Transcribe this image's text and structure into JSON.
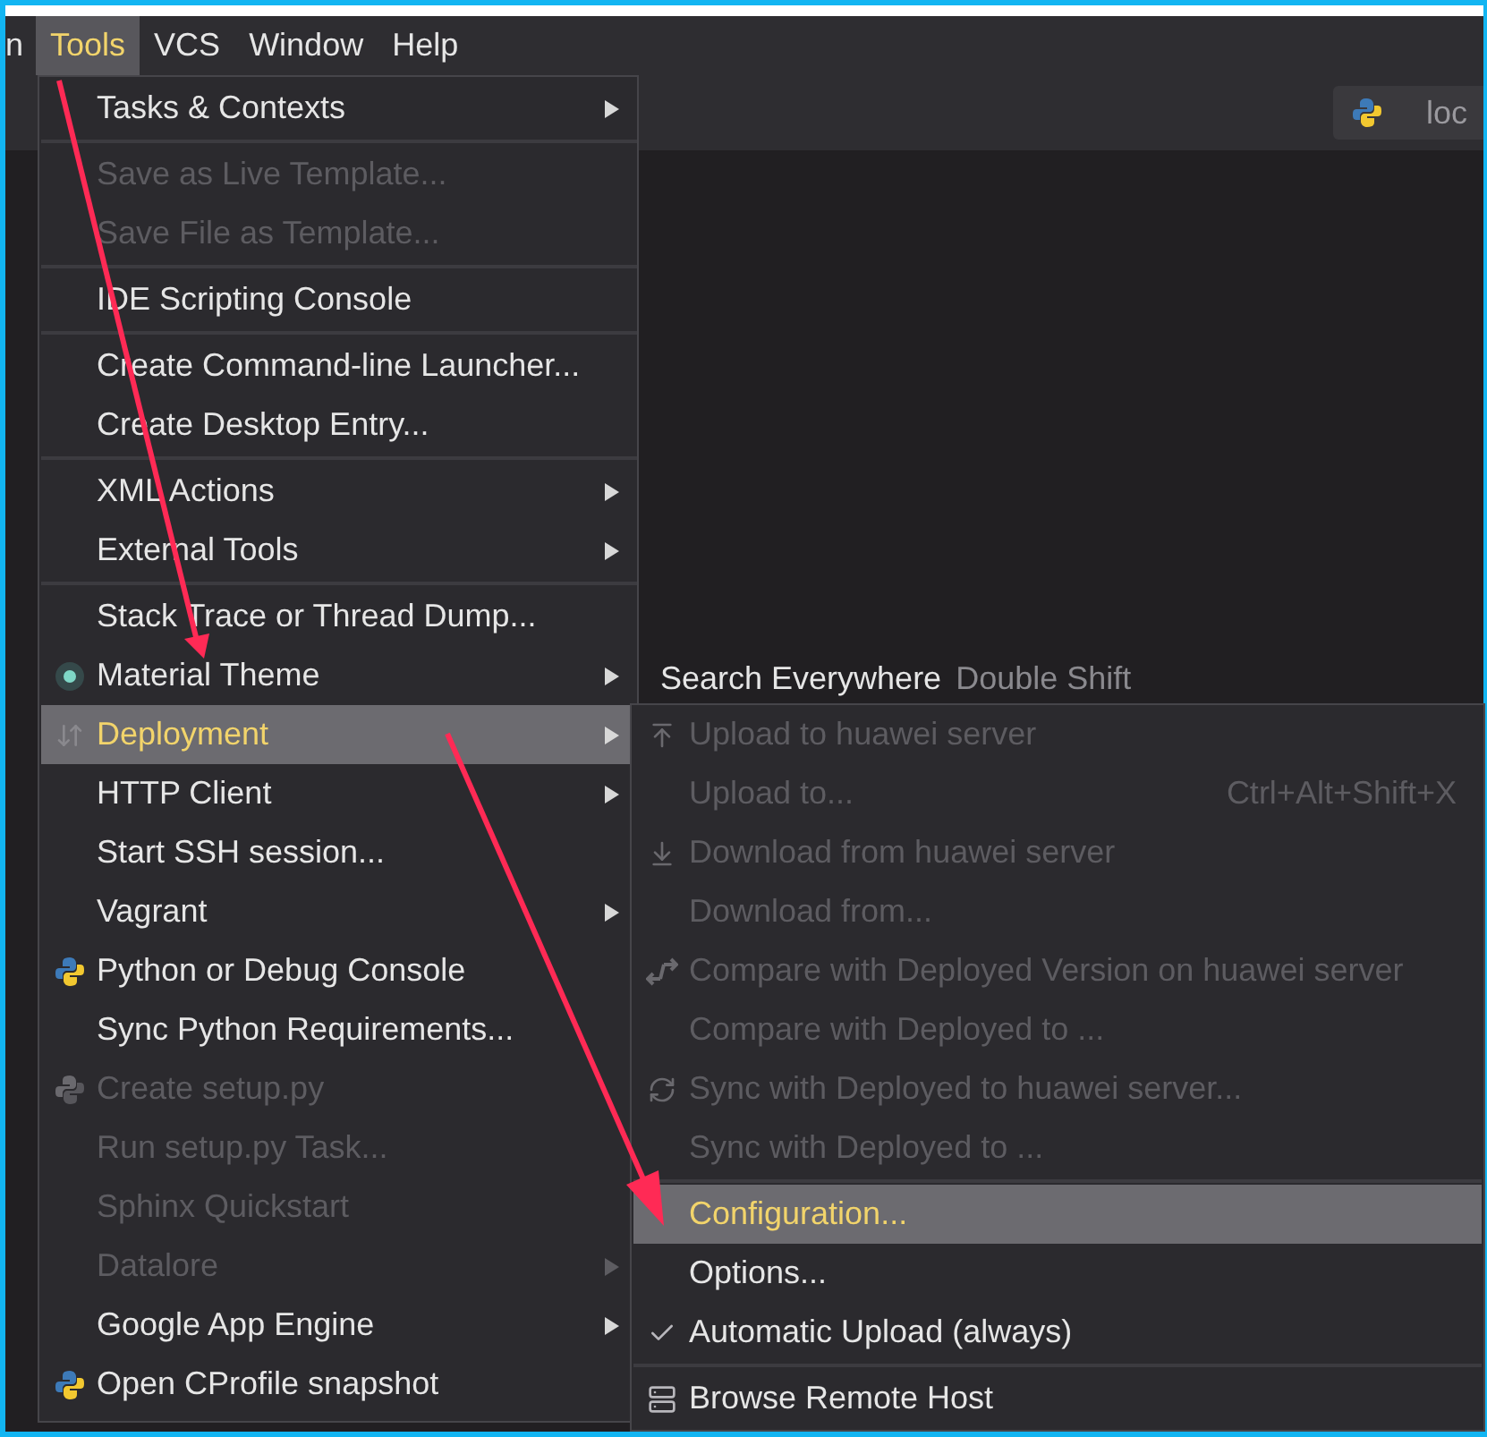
{
  "menu_bar": [
    {
      "label": "n",
      "selected": false
    },
    {
      "label": "Tools",
      "selected": true
    },
    {
      "label": "VCS",
      "selected": false
    },
    {
      "label": "Window",
      "selected": false
    },
    {
      "label": "Help",
      "selected": false
    }
  ],
  "editor_tab": {
    "label": "loc"
  },
  "hint": {
    "label": "Search Everywhere",
    "shortcut": "Double Shift"
  },
  "tools_menu": [
    {
      "kind": "item",
      "label": "Tasks & Contexts",
      "disabled": false,
      "submenu": true,
      "selected": false
    },
    {
      "kind": "separator"
    },
    {
      "kind": "item",
      "label": "Save as Live Template...",
      "disabled": true,
      "submenu": false,
      "selected": false
    },
    {
      "kind": "item",
      "label": "Save File as Template...",
      "disabled": true,
      "submenu": false,
      "selected": false
    },
    {
      "kind": "separator"
    },
    {
      "kind": "item",
      "label": "IDE Scripting Console",
      "disabled": false,
      "submenu": false,
      "selected": false
    },
    {
      "kind": "separator"
    },
    {
      "kind": "item",
      "label": "Create Command-line Launcher...",
      "disabled": false,
      "submenu": false,
      "selected": false
    },
    {
      "kind": "item",
      "label": "Create Desktop Entry...",
      "disabled": false,
      "submenu": false,
      "selected": false
    },
    {
      "kind": "separator"
    },
    {
      "kind": "item",
      "label": "XML Actions",
      "disabled": false,
      "submenu": true,
      "selected": false
    },
    {
      "kind": "item",
      "label": "External Tools",
      "disabled": false,
      "submenu": true,
      "selected": false
    },
    {
      "kind": "separator"
    },
    {
      "kind": "item",
      "label": "Stack Trace or Thread Dump...",
      "disabled": false,
      "submenu": false,
      "selected": false
    },
    {
      "kind": "item",
      "label": "Material Theme",
      "disabled": false,
      "submenu": true,
      "selected": false
    },
    {
      "kind": "item",
      "label": "Deployment",
      "disabled": false,
      "submenu": true,
      "selected": true
    },
    {
      "kind": "item",
      "label": "HTTP Client",
      "disabled": false,
      "submenu": true,
      "selected": false
    },
    {
      "kind": "item",
      "label": "Start SSH session...",
      "disabled": false,
      "submenu": false,
      "selected": false
    },
    {
      "kind": "item",
      "label": "Vagrant",
      "disabled": false,
      "submenu": true,
      "selected": false
    },
    {
      "kind": "item",
      "label": "Python or Debug Console",
      "disabled": false,
      "submenu": false,
      "selected": false
    },
    {
      "kind": "item",
      "label": "Sync Python Requirements...",
      "disabled": false,
      "submenu": false,
      "selected": false
    },
    {
      "kind": "item",
      "label": "Create setup.py",
      "disabled": true,
      "submenu": false,
      "selected": false
    },
    {
      "kind": "item",
      "label": "Run setup.py Task...",
      "disabled": true,
      "submenu": false,
      "selected": false
    },
    {
      "kind": "item",
      "label": "Sphinx Quickstart",
      "disabled": true,
      "submenu": false,
      "selected": false
    },
    {
      "kind": "item",
      "label": "Datalore",
      "disabled": true,
      "submenu": true,
      "selected": false
    },
    {
      "kind": "item",
      "label": "Google App Engine",
      "disabled": false,
      "submenu": true,
      "selected": false
    },
    {
      "kind": "item",
      "label": "Open CProfile snapshot",
      "disabled": false,
      "submenu": false,
      "selected": false
    }
  ],
  "deployment_menu": [
    {
      "kind": "item",
      "label": "Upload to huawei server",
      "disabled": true,
      "selected": false
    },
    {
      "kind": "item",
      "label": "Upload to...",
      "disabled": true,
      "selected": false,
      "shortcut": "Ctrl+Alt+Shift+X"
    },
    {
      "kind": "item",
      "label": "Download from huawei server",
      "disabled": true,
      "selected": false
    },
    {
      "kind": "item",
      "label": "Download from...",
      "disabled": true,
      "selected": false
    },
    {
      "kind": "item",
      "label": "Compare with Deployed Version on huawei server",
      "disabled": true,
      "selected": false
    },
    {
      "kind": "item",
      "label": "Compare with Deployed to ...",
      "disabled": true,
      "selected": false
    },
    {
      "kind": "item",
      "label": "Sync with Deployed to huawei server...",
      "disabled": true,
      "selected": false
    },
    {
      "kind": "item",
      "label": "Sync with Deployed to ...",
      "disabled": true,
      "selected": false
    },
    {
      "kind": "separator"
    },
    {
      "kind": "item",
      "label": "Configuration...",
      "disabled": false,
      "selected": true
    },
    {
      "kind": "item",
      "label": "Options...",
      "disabled": false,
      "selected": false
    },
    {
      "kind": "item",
      "label": "Automatic Upload (always)",
      "disabled": false,
      "selected": false,
      "checked": true
    },
    {
      "kind": "separator"
    },
    {
      "kind": "item",
      "label": "Browse Remote Host",
      "disabled": false,
      "selected": false
    }
  ]
}
